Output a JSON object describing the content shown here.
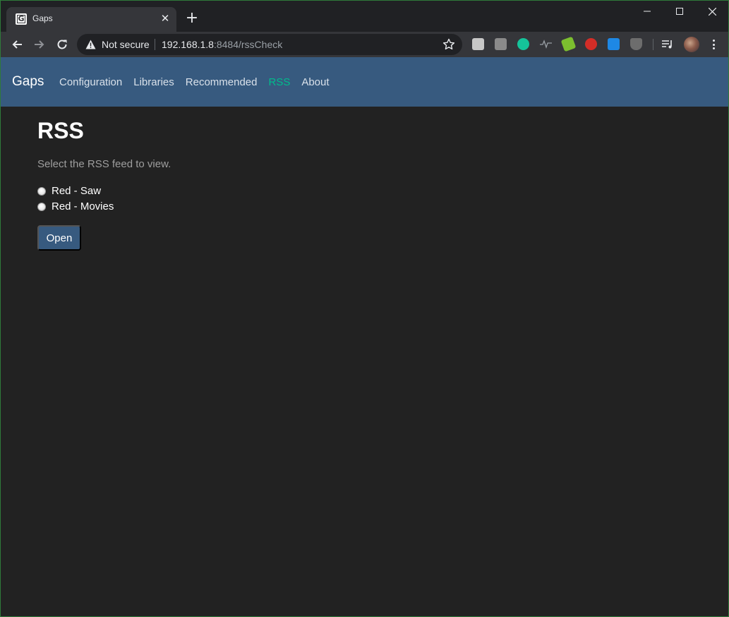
{
  "browser": {
    "tab_title": "Gaps",
    "favicon_letter": "G",
    "new_tab_symbol": "+",
    "close_symbol": "✕",
    "security_label": "Not secure",
    "url_host": "192.168.1.8",
    "url_rest": ":8484/rssCheck",
    "extension_icons": [
      "hackernews-icon",
      "chart-icon",
      "grammarly-icon",
      "pulse-icon",
      "edit-icon",
      "lastpass-icon",
      "ext-blue-icon",
      "ublock-icon",
      "media-icon"
    ],
    "colors": {
      "frame": "#202124",
      "toolbar": "#35363a",
      "grammarly": "#15c39a",
      "lastpass": "#d32d27"
    }
  },
  "navbar": {
    "brand": "Gaps",
    "links": [
      {
        "label": "Configuration",
        "active": false
      },
      {
        "label": "Libraries",
        "active": false
      },
      {
        "label": "Recommended",
        "active": false
      },
      {
        "label": "RSS",
        "active": true
      },
      {
        "label": "About",
        "active": false
      }
    ],
    "colors": {
      "background": "#375a7f",
      "active": "#00bc8c"
    }
  },
  "page": {
    "title": "RSS",
    "subtitle": "Select the RSS feed to view.",
    "feeds": [
      {
        "label": "Red - Saw",
        "selected": false
      },
      {
        "label": "Red - Movies",
        "selected": false
      }
    ],
    "open_button": "Open"
  }
}
